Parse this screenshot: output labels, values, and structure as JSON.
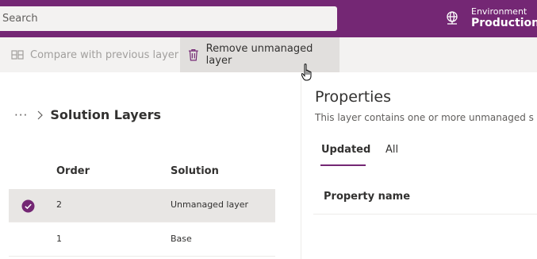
{
  "colors": {
    "brand": "#742774",
    "commandbar": "#f3f2f1",
    "selected_row": "#e8e6e4"
  },
  "header": {
    "search": {
      "placeholder": "Search"
    },
    "environment": {
      "label": "Environment",
      "value": "Production",
      "icon": "globe-icon"
    }
  },
  "commandbar": {
    "compare": {
      "label": "Compare with previous layer",
      "icon": "compare-icon",
      "enabled": false
    },
    "remove": {
      "label": "Remove unmanaged layer",
      "icon": "trash-icon",
      "enabled": true
    }
  },
  "breadcrumb": {
    "overflow": "···",
    "title": "Solution Layers"
  },
  "layers_table": {
    "columns": [
      "Order",
      "Solution"
    ],
    "rows": [
      {
        "order": "2",
        "solution": "Unmanaged layer",
        "selected": true
      },
      {
        "order": "1",
        "solution": "Base",
        "selected": false
      }
    ]
  },
  "properties": {
    "title": "Properties",
    "description": "This layer contains one or more unmanaged s",
    "tabs": [
      {
        "label": "Updated",
        "active": true
      },
      {
        "label": "All",
        "active": false
      }
    ],
    "columns": [
      "Property name"
    ]
  }
}
